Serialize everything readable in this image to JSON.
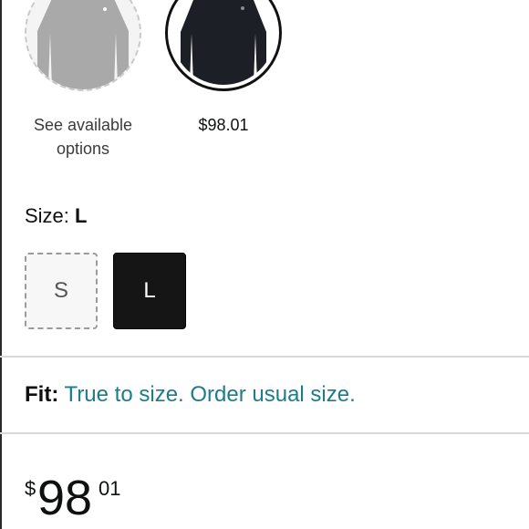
{
  "options": [
    {
      "label": "See available options",
      "color_name": "grey",
      "color": "#9a9a9a",
      "selected": false
    },
    {
      "label": "$98.01",
      "color_name": "black",
      "color": "#1c1f26",
      "selected": true
    }
  ],
  "size": {
    "label": "Size:",
    "selected": "L",
    "options": [
      "S",
      "L"
    ]
  },
  "fit": {
    "label": "Fit:",
    "text": "True to size. Order usual size."
  },
  "price": {
    "symbol": "$",
    "whole": "98",
    "fraction": "01"
  }
}
